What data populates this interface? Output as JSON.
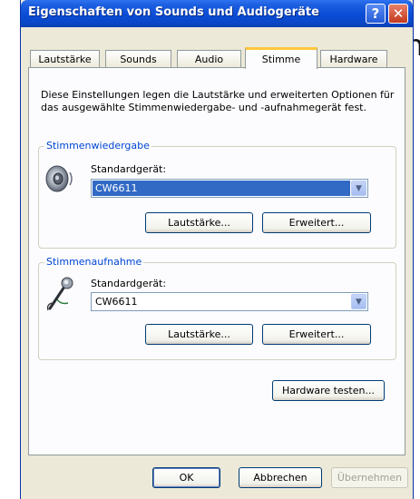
{
  "background": {
    "partial_char": "n"
  },
  "window": {
    "title": "Eigenschaften von Sounds und Audiogeräte",
    "help_glyph": "?",
    "close_glyph": "✕"
  },
  "tabs": [
    {
      "label": "Lautstärke",
      "active": false
    },
    {
      "label": "Sounds",
      "active": false
    },
    {
      "label": "Audio",
      "active": false
    },
    {
      "label": "Stimme",
      "active": true
    },
    {
      "label": "Hardware",
      "active": false
    }
  ],
  "description": "Diese Einstellungen legen die Lautstärke und erweiterten Optionen für das ausgewählte Stimmenwiedergabe- und -aufnahmegerät fest.",
  "playback": {
    "legend": "Stimmenwiedergabe",
    "device_label": "Standardgerät:",
    "device_value": "CW6611",
    "volume_button": "Lautstärke...",
    "advanced_button": "Erweitert..."
  },
  "recording": {
    "legend": "Stimmenaufnahme",
    "device_label": "Standardgerät:",
    "device_value": "CW6611",
    "volume_button": "Lautstärke...",
    "advanced_button": "Erweitert..."
  },
  "test_hardware_button": "Hardware testen...",
  "footer": {
    "ok": "OK",
    "cancel": "Abbrechen",
    "apply": "Übernehmen"
  },
  "colors": {
    "title_bar": "#0a4cd6",
    "group_legend": "#0046d5",
    "selection": "#316ac5",
    "active_tab_accent": "#ffc83c"
  },
  "icons": [
    "help-icon",
    "close-icon",
    "speaker-icon",
    "microphone-icon",
    "dropdown-arrow-icon"
  ]
}
